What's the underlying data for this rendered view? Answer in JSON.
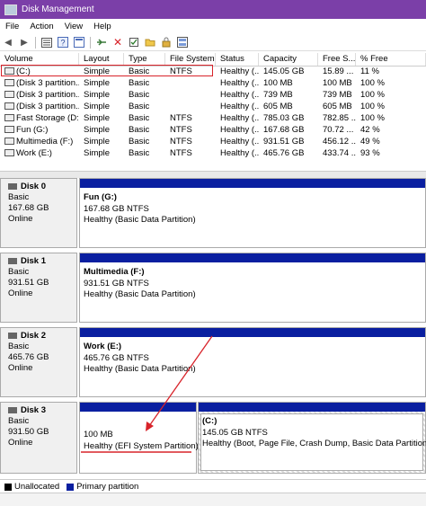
{
  "window": {
    "title": "Disk Management"
  },
  "menu": [
    "File",
    "Action",
    "View",
    "Help"
  ],
  "toolbar": [
    "back-icon",
    "forward-icon",
    "",
    "list-icon",
    "help-icon",
    "properties-icon",
    "",
    "connect-icon",
    "delete-icon",
    "checkbox-icon",
    "folder-icon",
    "lock-icon",
    "view-icon"
  ],
  "columns": [
    "Volume",
    "Layout",
    "Type",
    "File System",
    "Status",
    "Capacity",
    "Free S...",
    "% Free"
  ],
  "volumes": [
    {
      "vol": "(C:)",
      "layout": "Simple",
      "type": "Basic",
      "fs": "NTFS",
      "status": "Healthy (...",
      "cap": "145.05 GB",
      "free": "15.89 ...",
      "pct": "11 %"
    },
    {
      "vol": "(Disk 3 partition...",
      "layout": "Simple",
      "type": "Basic",
      "fs": "",
      "status": "Healthy (...",
      "cap": "100 MB",
      "free": "100 MB",
      "pct": "100 %"
    },
    {
      "vol": "(Disk 3 partition...",
      "layout": "Simple",
      "type": "Basic",
      "fs": "",
      "status": "Healthy (...",
      "cap": "739 MB",
      "free": "739 MB",
      "pct": "100 %"
    },
    {
      "vol": "(Disk 3 partition...",
      "layout": "Simple",
      "type": "Basic",
      "fs": "",
      "status": "Healthy (...",
      "cap": "605 MB",
      "free": "605 MB",
      "pct": "100 %"
    },
    {
      "vol": "Fast Storage (D:)",
      "layout": "Simple",
      "type": "Basic",
      "fs": "NTFS",
      "status": "Healthy (...",
      "cap": "785.03 GB",
      "free": "782.85 ...",
      "pct": "100 %"
    },
    {
      "vol": "Fun (G:)",
      "layout": "Simple",
      "type": "Basic",
      "fs": "NTFS",
      "status": "Healthy (...",
      "cap": "167.68 GB",
      "free": "70.72 ...",
      "pct": "42 %"
    },
    {
      "vol": "Multimedia (F:)",
      "layout": "Simple",
      "type": "Basic",
      "fs": "NTFS",
      "status": "Healthy (...",
      "cap": "931.51 GB",
      "free": "456.12 ...",
      "pct": "49 %"
    },
    {
      "vol": "Work (E:)",
      "layout": "Simple",
      "type": "Basic",
      "fs": "NTFS",
      "status": "Healthy (...",
      "cap": "465.76 GB",
      "free": "433.74 ...",
      "pct": "93 %"
    }
  ],
  "disks": [
    {
      "name": "Disk 0",
      "type": "Basic",
      "size": "167.68 GB",
      "state": "Online",
      "parts": [
        {
          "label": "Fun  (G:)",
          "size": "167.68 GB NTFS",
          "status": "Healthy (Basic Data Partition)"
        }
      ]
    },
    {
      "name": "Disk 1",
      "type": "Basic",
      "size": "931.51 GB",
      "state": "Online",
      "parts": [
        {
          "label": "Multimedia  (F:)",
          "size": "931.51 GB NTFS",
          "status": "Healthy (Basic Data Partition)"
        }
      ]
    },
    {
      "name": "Disk 2",
      "type": "Basic",
      "size": "465.76 GB",
      "state": "Online",
      "parts": [
        {
          "label": "Work  (E:)",
          "size": "465.76 GB NTFS",
          "status": "Healthy (Basic Data Partition)"
        }
      ]
    },
    {
      "name": "Disk 3",
      "type": "Basic",
      "size": "931.50 GB",
      "state": "Online",
      "parts": [
        {
          "label": "",
          "size": "100 MB",
          "status": "Healthy (EFI System Partition)"
        },
        {
          "label": "(C:)",
          "size": "145.05 GB NTFS",
          "status": "Healthy (Boot, Page File, Crash Dump, Basic Data Partition)"
        }
      ]
    }
  ],
  "legend": [
    {
      "label": "Unallocated",
      "color": "#000000"
    },
    {
      "label": "Primary partition",
      "color": "#0a1fa0"
    }
  ],
  "colors": {
    "titlebar": "#7b3fa8",
    "partition_bar": "#0a1fa0",
    "annotation": "#d8232a"
  }
}
